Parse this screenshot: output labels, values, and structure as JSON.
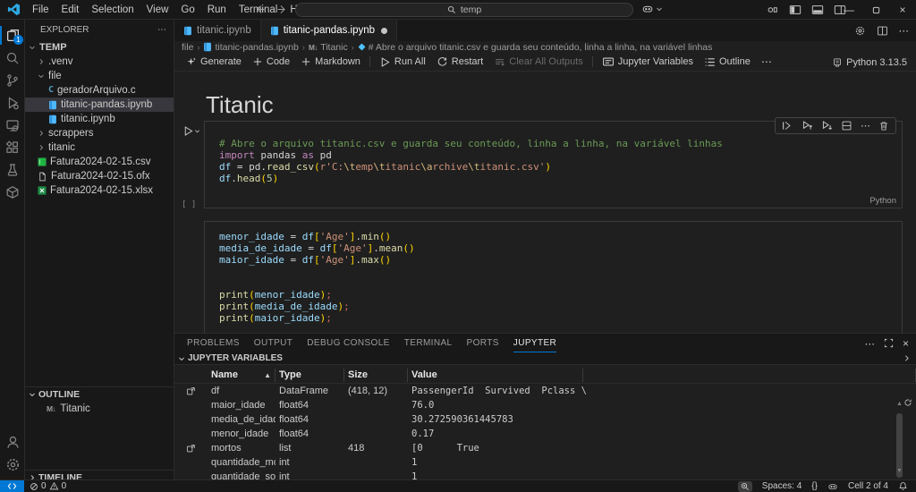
{
  "colors": {
    "accent": "#0078d4",
    "remote_badge": "#0078d4",
    "notebook_icon": "#4db8ff",
    "spreadsheet_icon": "#28a745",
    "c_icon": "#519aba",
    "symbol_icon": "#4fc1ff"
  },
  "titlebar": {
    "menus": [
      "File",
      "Edit",
      "Selection",
      "View",
      "Go",
      "Run",
      "Terminal",
      "Help"
    ],
    "search_value": "temp"
  },
  "activitybar": {
    "top": [
      {
        "name": "explorer",
        "active": true,
        "badge": "1"
      },
      {
        "name": "search"
      },
      {
        "name": "source-control"
      },
      {
        "name": "run-debug"
      },
      {
        "name": "remote-explorer"
      },
      {
        "name": "extensions"
      },
      {
        "name": "testing"
      },
      {
        "name": "package"
      }
    ],
    "bottom": [
      {
        "name": "accounts"
      },
      {
        "name": "settings"
      }
    ]
  },
  "sidebar": {
    "title": "EXPLORER",
    "root": "TEMP",
    "items": [
      {
        "label": ".venv",
        "kind": "folder",
        "expanded": false,
        "indent": 1
      },
      {
        "label": "file",
        "kind": "folder",
        "expanded": true,
        "indent": 1
      },
      {
        "label": "geradorArquivo.c",
        "kind": "c",
        "indent": 2
      },
      {
        "label": "titanic-pandas.ipynb",
        "kind": "notebook",
        "indent": 2,
        "selected": true
      },
      {
        "label": "titanic.ipynb",
        "kind": "notebook",
        "indent": 2
      },
      {
        "label": "scrappers",
        "kind": "folder",
        "expanded": false,
        "indent": 1
      },
      {
        "label": "titanic",
        "kind": "folder",
        "expanded": false,
        "indent": 1
      },
      {
        "label": "Fatura2024-02-15.csv",
        "kind": "csv",
        "indent": 1
      },
      {
        "label": "Fatura2024-02-15.ofx",
        "kind": "file",
        "indent": 1
      },
      {
        "label": "Fatura2024-02-15.xlsx",
        "kind": "xlsx",
        "indent": 1
      }
    ],
    "outline": {
      "label": "OUTLINE",
      "items": [
        {
          "label": "Titanic",
          "icon": "markdown"
        }
      ]
    },
    "timeline": {
      "label": "TIMELINE"
    }
  },
  "editor": {
    "tabs": [
      {
        "label": "titanic.ipynb",
        "active": false,
        "modified": false
      },
      {
        "label": "titanic-pandas.ipynb",
        "active": true,
        "modified": true
      }
    ],
    "breadcrumb": [
      {
        "label": "file"
      },
      {
        "label": "titanic-pandas.ipynb",
        "icon": "notebook"
      },
      {
        "label": "Titanic",
        "icon": "markdown"
      },
      {
        "label": "# Abre o arquivo titanic.csv e guarda seu conteúdo, linha a linha, na variável linhas",
        "icon": "symbol"
      }
    ],
    "toolbar": {
      "items": [
        {
          "icon": "sparkle",
          "label": "Generate"
        },
        {
          "icon": "plus",
          "label": "Code"
        },
        {
          "icon": "plus",
          "label": "Markdown"
        },
        {
          "divider": true
        },
        {
          "icon": "run",
          "label": "Run All"
        },
        {
          "icon": "restart",
          "label": "Restart"
        },
        {
          "icon": "clear",
          "label": "Clear All Outputs",
          "disabled": true
        },
        {
          "divider": true
        },
        {
          "icon": "vars",
          "label": "Jupyter Variables"
        },
        {
          "icon": "list",
          "label": "Outline"
        },
        {
          "icon": "more",
          "label": ""
        }
      ],
      "kernel": "Python 3.13.5"
    }
  },
  "notebook": {
    "title": "Titanic",
    "cells": [
      {
        "exec": "[ ]",
        "lang": "Python",
        "lines": [
          [
            [
              "cm",
              "# Abre o arquivo titanic.csv e guarda seu conteúdo, linha a linha, na variável linhas"
            ]
          ],
          [
            [
              "kw",
              "import"
            ],
            [
              "pl",
              " pandas "
            ],
            [
              "kw",
              "as"
            ],
            [
              "pl",
              " pd"
            ]
          ],
          [
            [
              "vr",
              "df"
            ],
            [
              "pl",
              " = "
            ],
            [
              "pl",
              "pd."
            ],
            [
              "fn",
              "read_csv"
            ],
            [
              "br",
              "("
            ],
            [
              "st",
              "r'C:"
            ],
            [
              "es",
              "\\t"
            ],
            [
              "st",
              "emp"
            ],
            [
              "es",
              "\\t"
            ],
            [
              "st",
              "itanic"
            ],
            [
              "es",
              "\\a"
            ],
            [
              "st",
              "rchive"
            ],
            [
              "es",
              "\\t"
            ],
            [
              "st",
              "itanic.csv'"
            ],
            [
              "br",
              ")"
            ]
          ],
          [
            [
              "vr",
              "df"
            ],
            [
              "pl",
              "."
            ],
            [
              "fn",
              "head"
            ],
            [
              "br",
              "("
            ],
            [
              "nu",
              "5"
            ],
            [
              "br",
              ")"
            ]
          ]
        ]
      },
      {
        "exec": "[ ]",
        "lang": "",
        "lines": [
          [
            [
              "vr",
              "menor_idade"
            ],
            [
              "pl",
              " = "
            ],
            [
              "vr",
              "df"
            ],
            [
              "br",
              "["
            ],
            [
              "st",
              "'Age'"
            ],
            [
              "br",
              "]"
            ],
            [
              "pl",
              "."
            ],
            [
              "fn",
              "min"
            ],
            [
              "br",
              "()"
            ]
          ],
          [
            [
              "vr",
              "media_de_idade"
            ],
            [
              "pl",
              " = "
            ],
            [
              "vr",
              "df"
            ],
            [
              "br",
              "["
            ],
            [
              "st",
              "'Age'"
            ],
            [
              "br",
              "]"
            ],
            [
              "pl",
              "."
            ],
            [
              "fn",
              "mean"
            ],
            [
              "br",
              "()"
            ]
          ],
          [
            [
              "vr",
              "maior_idade"
            ],
            [
              "pl",
              " = "
            ],
            [
              "vr",
              "df"
            ],
            [
              "br",
              "["
            ],
            [
              "st",
              "'Age'"
            ],
            [
              "br",
              "]"
            ],
            [
              "pl",
              "."
            ],
            [
              "fn",
              "max"
            ],
            [
              "br",
              "()"
            ]
          ],
          [],
          [],
          [
            [
              "fn",
              "print"
            ],
            [
              "br",
              "("
            ],
            [
              "vr",
              "menor_idade"
            ],
            [
              "br",
              ")"
            ],
            [
              "sm",
              ";"
            ]
          ],
          [
            [
              "fn",
              "print"
            ],
            [
              "br",
              "("
            ],
            [
              "vr",
              "media_de_idade"
            ],
            [
              "br",
              ")"
            ],
            [
              "sm",
              ";"
            ]
          ],
          [
            [
              "fn",
              "print"
            ],
            [
              "br",
              "("
            ],
            [
              "vr",
              "maior_idade"
            ],
            [
              "br",
              ")"
            ],
            [
              "sm",
              ";"
            ]
          ]
        ]
      }
    ]
  },
  "panel": {
    "tabs": [
      "PROBLEMS",
      "OUTPUT",
      "DEBUG CONSOLE",
      "TERMINAL",
      "PORTS",
      "JUPYTER"
    ],
    "active_tab": "JUPYTER",
    "section_label": "JUPYTER VARIABLES",
    "table": {
      "columns": [
        "Name",
        "Type",
        "Size",
        "Value"
      ],
      "rows": [
        {
          "icon": true,
          "name": "df",
          "type": "DataFrame",
          "size": "(418, 12)",
          "value": "PassengerId  Survived  Pclass \\"
        },
        {
          "icon": false,
          "name": "maior_idade",
          "type": "float64",
          "size": "",
          "value": "76.0"
        },
        {
          "icon": false,
          "name": "media_de_idade",
          "type": "float64",
          "size": "",
          "value": "30.272590361445783"
        },
        {
          "icon": false,
          "name": "menor_idade",
          "type": "float64",
          "size": "",
          "value": "0.17"
        },
        {
          "icon": true,
          "name": "mortos",
          "type": "list",
          "size": "418",
          "value": "[0      True"
        },
        {
          "icon": false,
          "name": "quantidade_mort",
          "type": "int",
          "size": "",
          "value": "1"
        },
        {
          "icon": false,
          "name": "quantidade_sobr",
          "type": "int",
          "size": "",
          "value": "1"
        }
      ]
    }
  },
  "statusbar": {
    "errors": "0",
    "warnings": "0",
    "spaces": "Spaces: 4",
    "brackets": "{}",
    "cell_indicator": "Cell 2 of 4"
  }
}
